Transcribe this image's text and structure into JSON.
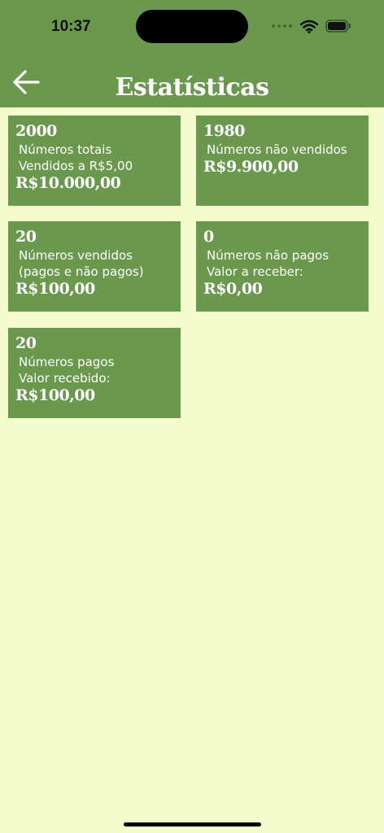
{
  "status_bar": {
    "time": "10:37"
  },
  "header": {
    "title": "Estatísticas",
    "back_icon": "arrow-left-icon"
  },
  "cards": [
    {
      "count": "2000",
      "line1": "Números totais",
      "line2": "Vendidos a  R$5,00",
      "amount": "R$10.000,00"
    },
    {
      "count": "1980",
      "line1": "Números não vendidos",
      "amount": "R$9.900,00"
    },
    {
      "count": "20",
      "line1": "Números vendidos",
      "line2": "(pagos e não pagos)",
      "amount": "R$100,00"
    },
    {
      "count": "0",
      "line1": "Números não pagos",
      "line2": "Valor a receber:",
      "amount": "R$0,00"
    },
    {
      "count": "20",
      "line1": "Números pagos",
      "line2": "Valor recebido:",
      "amount": "R$100,00"
    }
  ],
  "colors": {
    "header": "#6a994e",
    "background": "#f4fccb",
    "card": "#6a994e",
    "text": "#ffffff"
  }
}
